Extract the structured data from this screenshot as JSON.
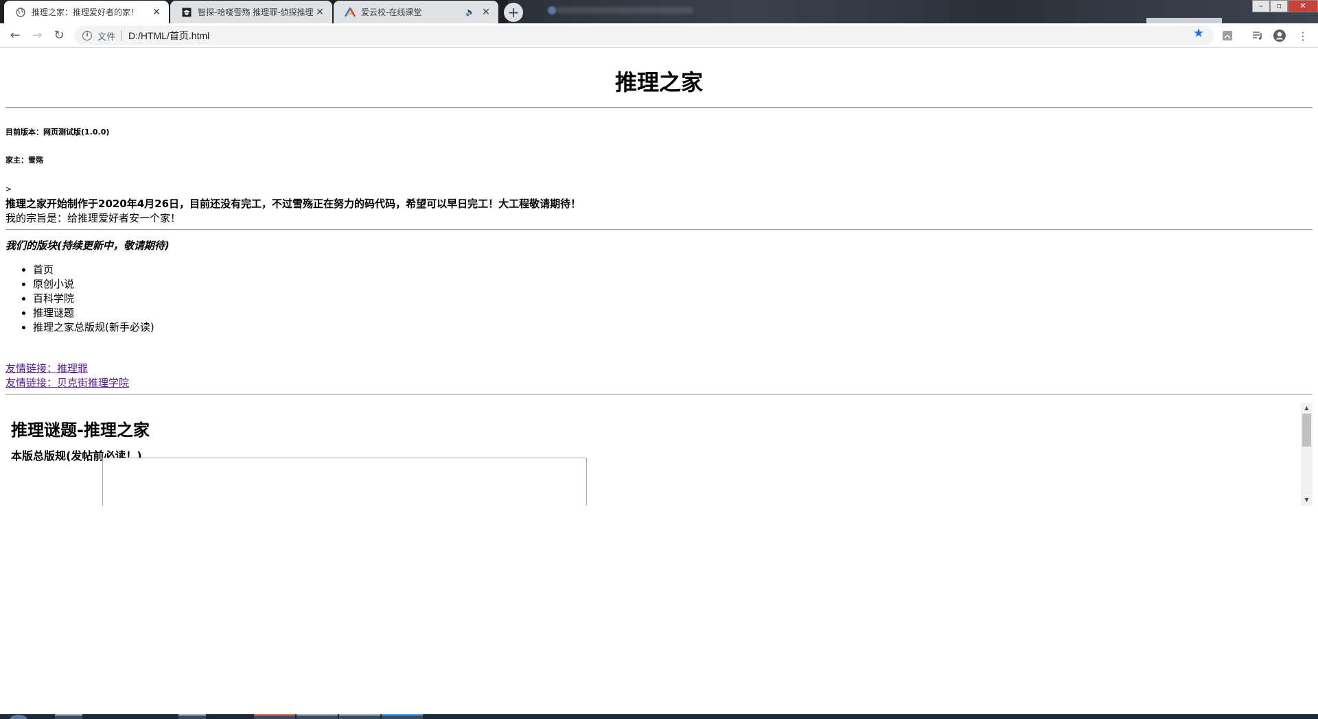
{
  "browser": {
    "tabs": [
      {
        "title": "推理之家：推理爱好者的家！",
        "active": true,
        "favicon": "globe-icon"
      },
      {
        "title": "智探-哈喽雪殇 推理罪-侦探推理",
        "active": false,
        "favicon": "graduation-cap-icon"
      },
      {
        "title": "爱云校-在线课堂",
        "active": false,
        "favicon": "a-logo-icon"
      }
    ],
    "address": {
      "scheme_label": "文件",
      "url": "D:/HTML/首页.html"
    },
    "close_glyph": "✕",
    "new_tab_glyph": "+"
  },
  "page": {
    "title": "推理之家",
    "version": "目前版本：网页测试版(1.0.0)",
    "owner": "家主：雪殇",
    "stray_char": ">",
    "intro_bold": "推理之家开始制作于2020年4月26日，目前还没有完工，不过雪殇正在努力的码代码，希望可以早日完工！大工程敬请期待！",
    "intro_normal": "我的宗旨是：给推理爱好者安一个家！",
    "sections_title": "我们的版块(持续更新中，敬请期待)",
    "sections": [
      "首页",
      "原创小说",
      "百科学院",
      "推理谜题",
      "推理之家总版规(新手必读)"
    ],
    "links": [
      "友情链接：推理罪",
      "友情链接：贝克街推理学院"
    ],
    "embedded": {
      "title": "推理谜题-推理之家",
      "rules_label": "本版总版规(发帖前必读！)"
    }
  },
  "colors": {
    "link_visited": "#551a8b",
    "star_accent": "#1a73e8",
    "titlebar": "#202124"
  }
}
